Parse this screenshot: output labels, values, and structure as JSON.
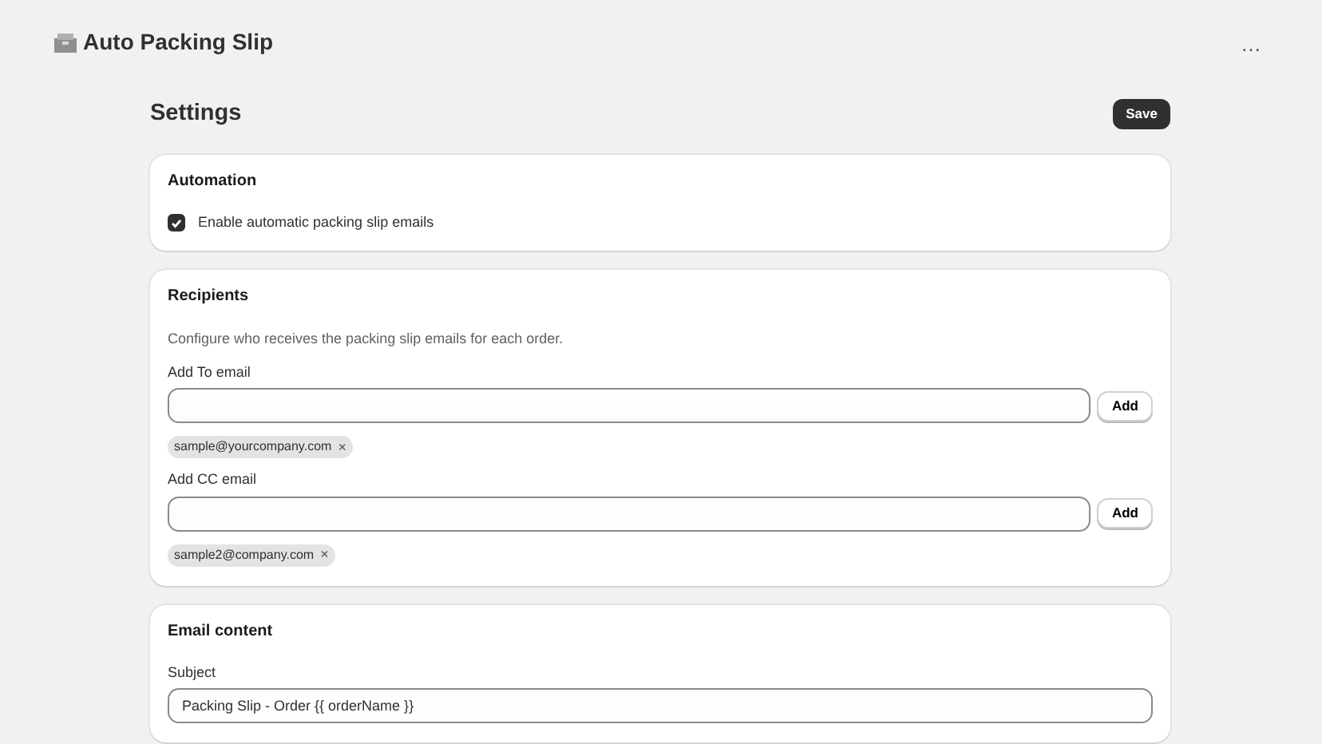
{
  "app": {
    "title": "Auto Packing Slip",
    "menu": "…"
  },
  "page": {
    "title": "Settings",
    "save": "Save"
  },
  "automation": {
    "title": "Automation",
    "label": "Enable automatic packing slip emails",
    "checked": true
  },
  "recipients": {
    "title": "Recipients",
    "description": "Configure who receives the packing slip emails for each order.",
    "groups": [
      {
        "label": "Add To email",
        "button": "Add",
        "tags": [
          {
            "text": "sample@yourcompany.com",
            "remove": "×"
          }
        ]
      },
      {
        "label": "Add CC email",
        "button": "Add",
        "tags": [
          {
            "text": "sample2@company.com",
            "remove": "×"
          }
        ]
      }
    ]
  },
  "email_content": {
    "title": "Email content",
    "subject_label": "Subject",
    "subject": "Packing Slip - Order {{ orderName }}"
  }
}
